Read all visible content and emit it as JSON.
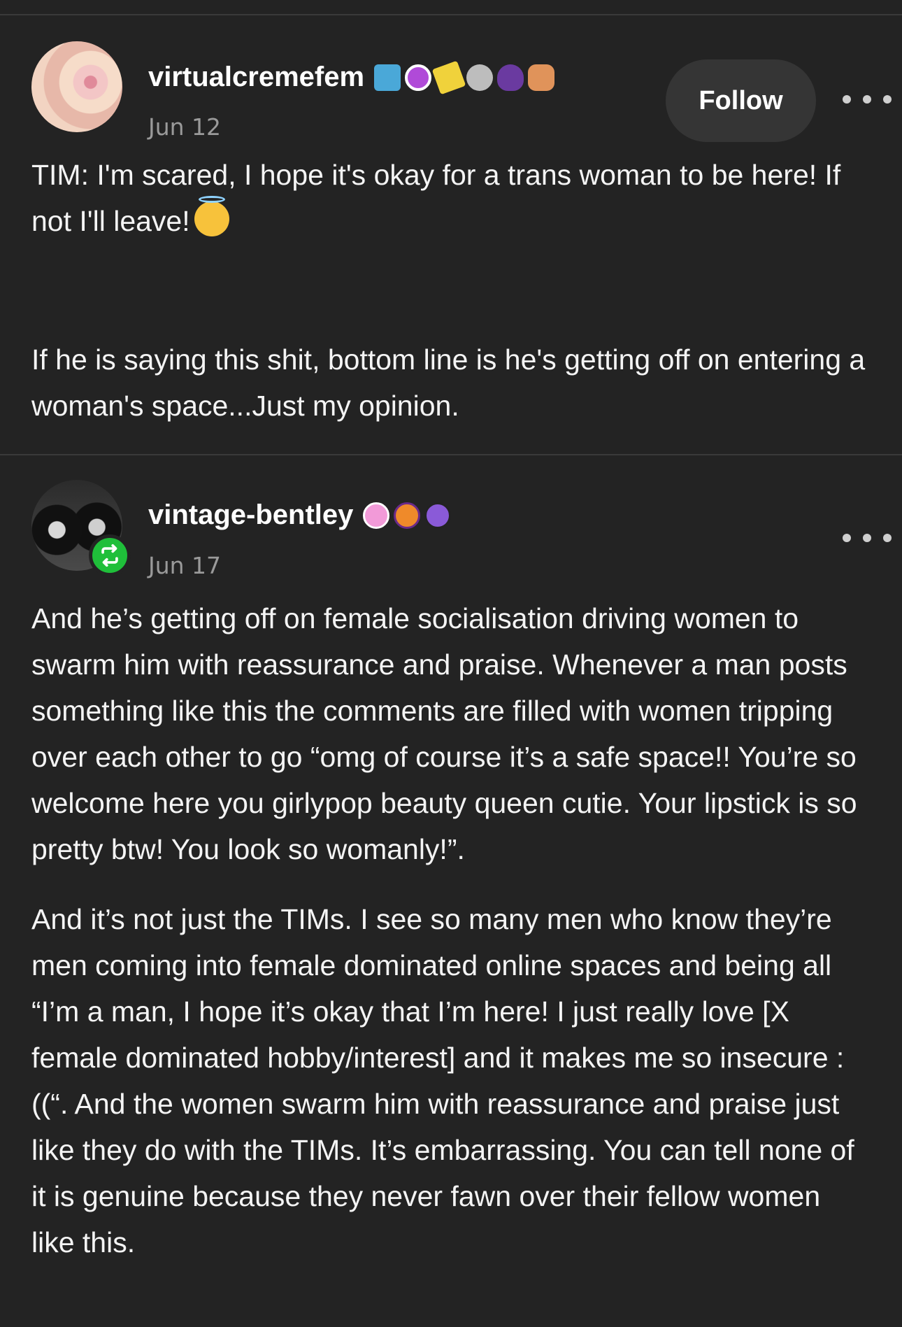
{
  "posts": [
    {
      "username": "virtualcremefem",
      "date": "Jun 12",
      "follow_label": "Follow",
      "badges": [
        {
          "icon": "zipper-badge-icon",
          "color": "#4aa8d8"
        },
        {
          "icon": "eye-face-badge-icon",
          "color": "#b04ad8"
        },
        {
          "icon": "tophat-badge-icon",
          "color": "#f0d23b"
        },
        {
          "icon": "skull-badge-icon",
          "color": "#bdbdbd"
        },
        {
          "icon": "witch-badge-icon",
          "color": "#6a3aa0"
        },
        {
          "icon": "hat-hand-badge-icon",
          "color": "#e0935a"
        }
      ],
      "paragraphs": [
        "TIM: I'm scared, I hope it's okay for a trans woman to be here! If not I'll leave!",
        "If he is saying this shit, bottom line is he's getting off on entering a woman's space...Just my opinion."
      ]
    },
    {
      "username": "vintage-bentley",
      "date": "Jun 17",
      "badges": [
        {
          "icon": "paw-pink-badge-icon",
          "color": "#f29ad8"
        },
        {
          "icon": "paw-orange-badge-icon",
          "color": "#ef8a2a"
        },
        {
          "icon": "paw-purple-badge-icon",
          "color": "#8a5ad8"
        }
      ],
      "paragraphs": [
        "And he’s getting off on female socialisation driving women to swarm him with reassurance and praise. Whenever a man posts something like this the comments are filled with women tripping over each other to go “omg of course it’s a safe space!! You’re so welcome here you girlypop beauty queen cutie. Your lipstick is so pretty btw! You look so womanly!”.",
        "And it’s not just the TIMs. I see so many men who know they’re men coming into female dominated online spaces and being all “I’m a man, I hope it’s okay that I’m here! I just really love [X female dominated hobby/interest] and it makes me so insecure :((“. And the women swarm him with reassurance and praise just like they do with the TIMs. It’s embarrassing. You can tell none of it is genuine because they never fawn over their fellow women like this."
      ]
    }
  ],
  "colors": {
    "background": "#232323",
    "text": "#f4f4f4",
    "muted": "#9a9a9a",
    "button_bg": "#353535",
    "reblog_green": "#1fbf3a"
  }
}
